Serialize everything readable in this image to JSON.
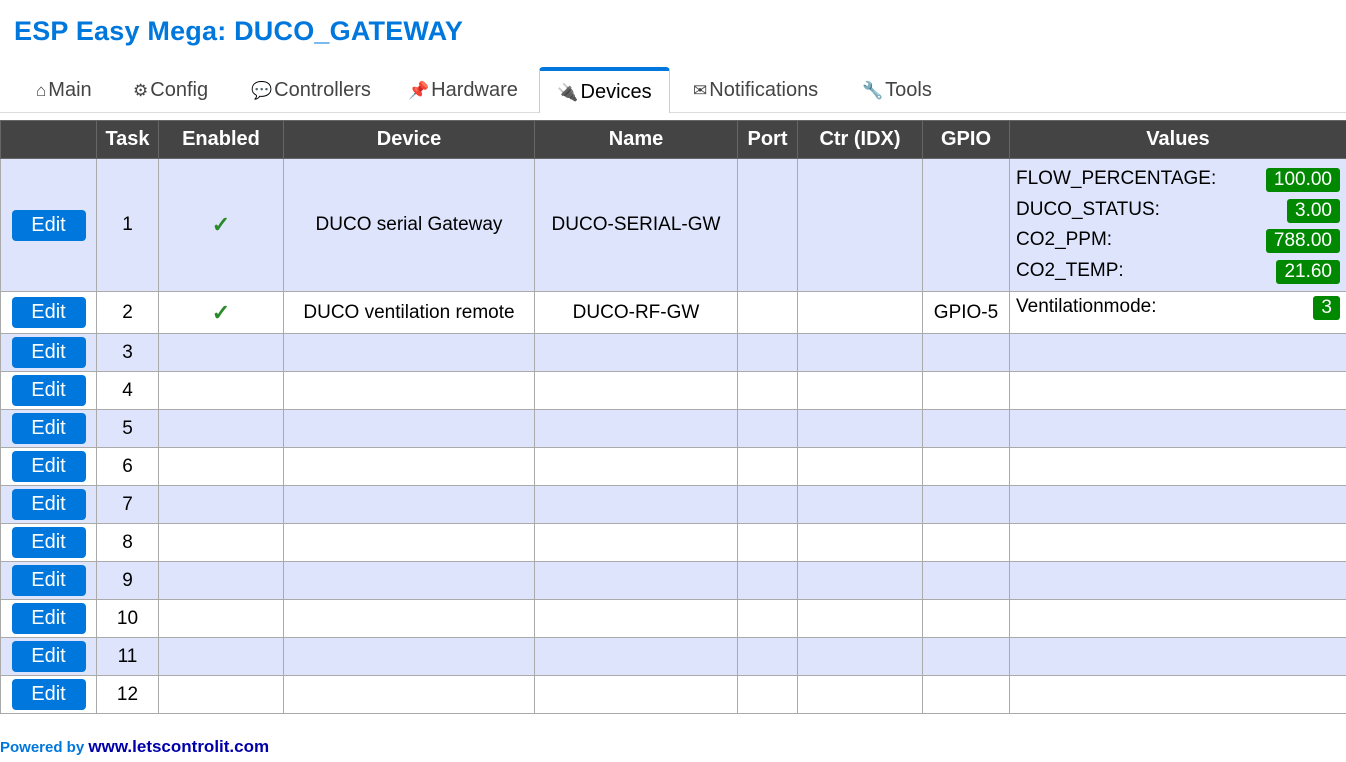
{
  "header": {
    "title": "ESP Easy Mega: DUCO_GATEWAY"
  },
  "tabs": [
    {
      "icon": "⌂",
      "label": "Main"
    },
    {
      "icon": "⚙",
      "label": "Config"
    },
    {
      "icon": "💬",
      "label": "Controllers"
    },
    {
      "icon": "📌",
      "label": "Hardware"
    },
    {
      "icon": "🔌",
      "label": "Devices"
    },
    {
      "icon": "✉",
      "label": "Notifications"
    },
    {
      "icon": "🔧",
      "label": "Tools"
    }
  ],
  "table": {
    "headers": [
      "",
      "Task",
      "Enabled",
      "Device",
      "Name",
      "Port",
      "Ctr (IDX)",
      "GPIO",
      "Values"
    ],
    "edit_label": "Edit",
    "rows": [
      {
        "task": "1",
        "enabled": "✓",
        "device": "DUCO serial Gateway",
        "name": "DUCO-SERIAL-GW",
        "port": "",
        "ctr": "",
        "gpio": "",
        "values": [
          {
            "label": "FLOW_PERCENTAGE:",
            "value": "100.00"
          },
          {
            "label": "DUCO_STATUS:",
            "value": "3.00"
          },
          {
            "label": "CO2_PPM:",
            "value": "788.00"
          },
          {
            "label": "CO2_TEMP:",
            "value": "21.60"
          }
        ]
      },
      {
        "task": "2",
        "enabled": "✓",
        "device": "DUCO ventilation remote",
        "name": "DUCO-RF-GW",
        "port": "",
        "ctr": "",
        "gpio": "GPIO-5",
        "values": [
          {
            "label": "Ventilationmode:",
            "value": "3"
          }
        ]
      },
      {
        "task": "3",
        "enabled": "",
        "device": "",
        "name": "",
        "port": "",
        "ctr": "",
        "gpio": "",
        "values": []
      },
      {
        "task": "4",
        "enabled": "",
        "device": "",
        "name": "",
        "port": "",
        "ctr": "",
        "gpio": "",
        "values": []
      },
      {
        "task": "5",
        "enabled": "",
        "device": "",
        "name": "",
        "port": "",
        "ctr": "",
        "gpio": "",
        "values": []
      },
      {
        "task": "6",
        "enabled": "",
        "device": "",
        "name": "",
        "port": "",
        "ctr": "",
        "gpio": "",
        "values": []
      },
      {
        "task": "7",
        "enabled": "",
        "device": "",
        "name": "",
        "port": "",
        "ctr": "",
        "gpio": "",
        "values": []
      },
      {
        "task": "8",
        "enabled": "",
        "device": "",
        "name": "",
        "port": "",
        "ctr": "",
        "gpio": "",
        "values": []
      },
      {
        "task": "9",
        "enabled": "",
        "device": "",
        "name": "",
        "port": "",
        "ctr": "",
        "gpio": "",
        "values": []
      },
      {
        "task": "10",
        "enabled": "",
        "device": "",
        "name": "",
        "port": "",
        "ctr": "",
        "gpio": "",
        "values": []
      },
      {
        "task": "11",
        "enabled": "",
        "device": "",
        "name": "",
        "port": "",
        "ctr": "",
        "gpio": "",
        "values": []
      },
      {
        "task": "12",
        "enabled": "",
        "device": "",
        "name": "",
        "port": "",
        "ctr": "",
        "gpio": "",
        "values": []
      }
    ]
  },
  "footer": {
    "prefix": "Powered by",
    "link": "www.letscontrolit.com"
  },
  "colors": {
    "accent": "#0077dd",
    "header_bg": "#444444",
    "row_alt": "#dde4fb",
    "value_badge": "#008800"
  }
}
